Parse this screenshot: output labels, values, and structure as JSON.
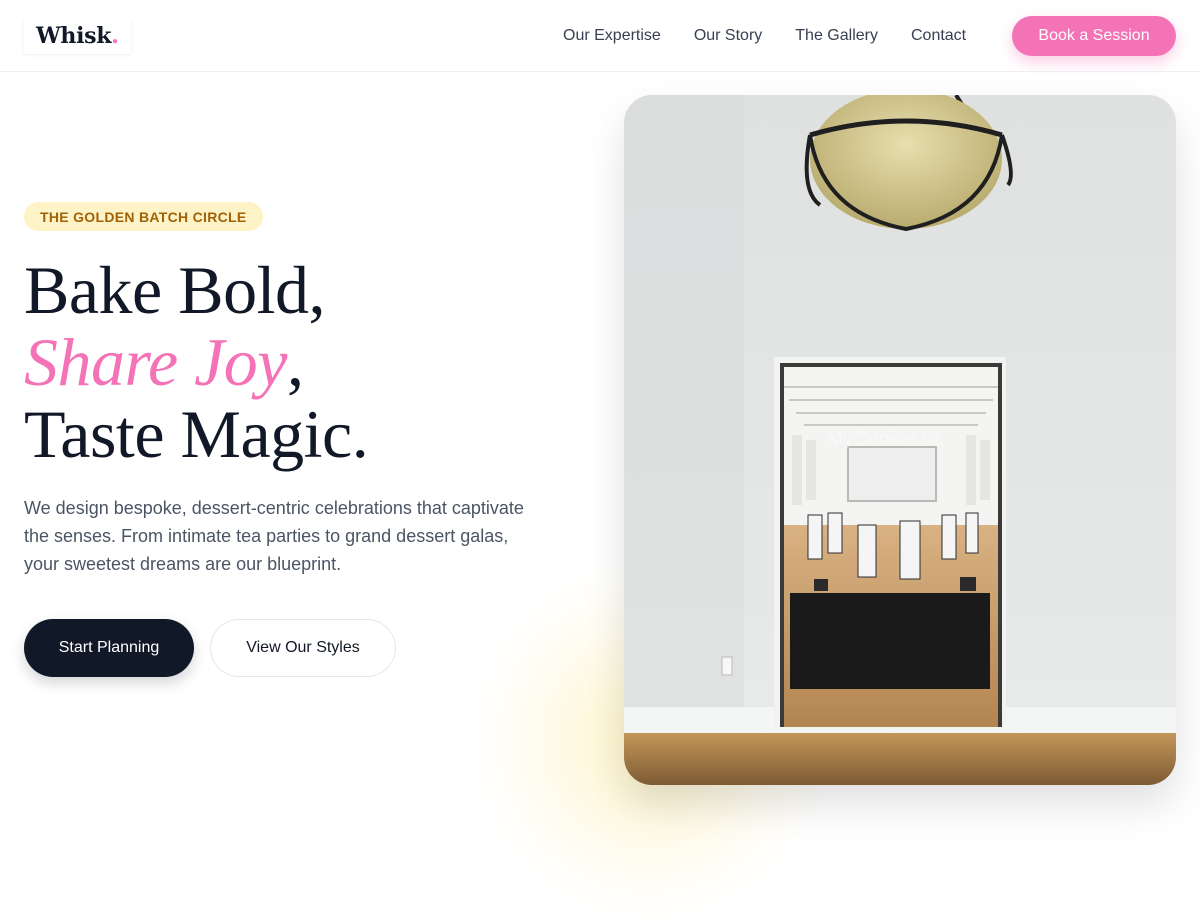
{
  "header": {
    "logo": {
      "text": "Whisk",
      "dot": "."
    },
    "nav": [
      "Our Expertise",
      "Our Story",
      "The Gallery",
      "Contact"
    ],
    "cta_label": "Book a Session"
  },
  "hero": {
    "badge": "THE GOLDEN BATCH CIRCLE",
    "headline": {
      "line1": "Bake Bold,",
      "line2_accent": "Share Joy",
      "line2_suffix": ",",
      "line3": "Taste Magic."
    },
    "description": "We design bespoke, dessert-centric celebrations that captivate the senses. From intimate tea parties to grand dessert galas, your sweetest dreams are our blueprint.",
    "primary_button": "Start Planning",
    "secondary_button": "View Our Styles",
    "image": {
      "icon": "venue-photo",
      "watermark": "MyCookie.cz"
    }
  },
  "colors": {
    "accent_pink": "#f472b6",
    "dark": "#111827",
    "badge_bg": "#fef3c7",
    "badge_text": "#a16207"
  }
}
